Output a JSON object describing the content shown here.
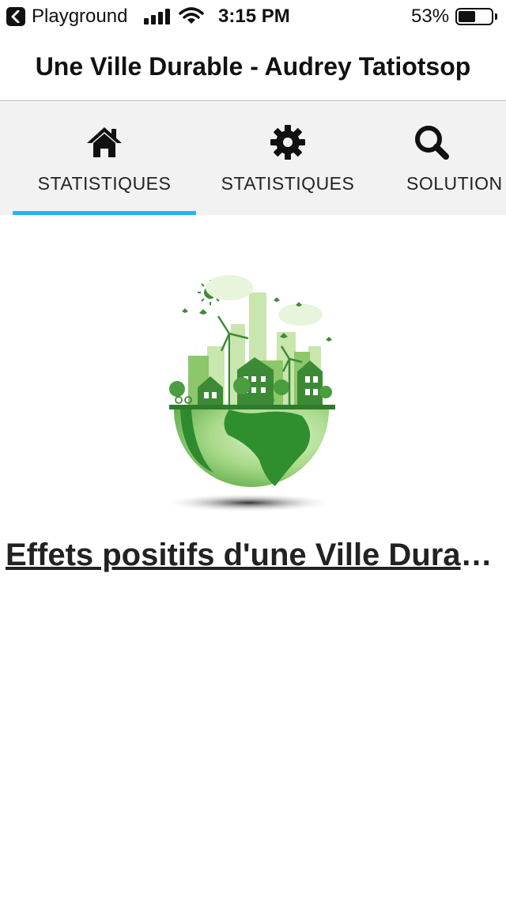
{
  "status_bar": {
    "back_app": "Playground",
    "time": "3:15 PM",
    "battery_percent": "53%",
    "battery_level": 0.53,
    "icons": [
      "back-chevron-icon",
      "signal-icon",
      "wifi-icon",
      "battery-icon"
    ]
  },
  "header": {
    "title": "Une Ville Durable - Audrey Tatiotsop"
  },
  "tabs": [
    {
      "label": "STATISTIQUES",
      "icon": "home-icon",
      "selected": true
    },
    {
      "label": "STATISTIQUES",
      "icon": "gear-icon",
      "selected": false
    },
    {
      "label": "SOLUTION",
      "icon": "search-icon",
      "selected": false
    }
  ],
  "main": {
    "illustration": "sustainable-city-globe-illustration",
    "article_title": "Effets positifs d'une Ville Durable"
  },
  "colors": {
    "tab_indicator": "#2ab0f0",
    "tab_bar_bg": "#f2f2f2",
    "text": "#222222",
    "illustration_green": "#3d9b3a"
  }
}
